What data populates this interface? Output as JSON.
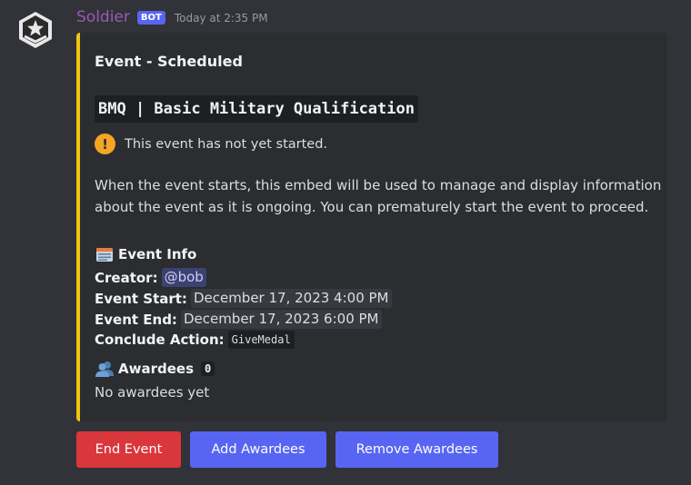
{
  "message": {
    "username": "Soldier",
    "bot_tag": "BOT",
    "timestamp": "Today at 2:35 PM",
    "avatar_icon": "military-rank-star-icon"
  },
  "embed": {
    "accent_color": "#f1c40f",
    "title": "Event - Scheduled",
    "event_name": "BMQ | Basic Military Qualification",
    "status_icon": "exclamation-icon",
    "status_text": "This event has not yet started.",
    "description_line1": "When the event starts, this embed will be used to manage and display information",
    "description_line2": "about the event as it is ongoing. You can prematurely start the event to proceed.",
    "info": {
      "icon": "card-index-icon",
      "heading": "Event Info",
      "creator_label": "Creator:",
      "creator_value": "@bob",
      "start_label": "Event Start:",
      "start_value": "December 17, 2023 4:00 PM",
      "end_label": "Event End:",
      "end_value": "December 17, 2023 6:00 PM",
      "conclude_label": "Conclude Action:",
      "conclude_value": "GiveMedal"
    },
    "awardees": {
      "icon": "busts-in-silhouette-icon",
      "heading": "Awardees",
      "count": "0",
      "empty_text": "No awardees yet"
    }
  },
  "buttons": {
    "end_event": "End Event",
    "add_awardees": "Add Awardees",
    "remove_awardees": "Remove Awardees"
  },
  "colors": {
    "background": "#313338",
    "embed_background": "#2b2d31",
    "danger": "#da373c",
    "primary": "#5865f2",
    "username": "#9b59b6"
  }
}
